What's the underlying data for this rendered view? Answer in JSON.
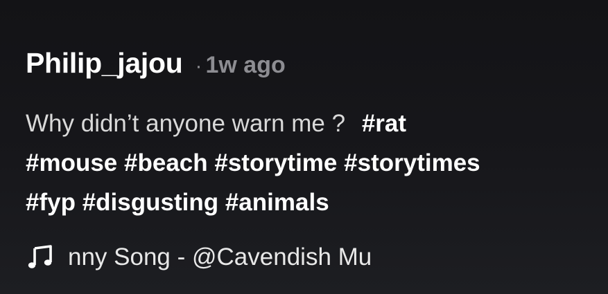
{
  "post": {
    "author": "Philip_jajou",
    "separator": "·",
    "time_ago": "1w ago",
    "caption": "Why didn’t anyone warn me ?",
    "hashtags_line1": [
      "#rat"
    ],
    "hashtags_line2": [
      "#mouse",
      "#beach",
      "#storytime",
      "#storytimes"
    ],
    "hashtags_line3": [
      "#fyp",
      "#disgusting",
      "#animals"
    ]
  },
  "music": {
    "icon": "music-note-icon",
    "text": "nny Song - @Cavendish Mu"
  },
  "colors": {
    "background": "#141417",
    "primary_text": "#ffffff",
    "secondary_text": "#8d8d92"
  }
}
